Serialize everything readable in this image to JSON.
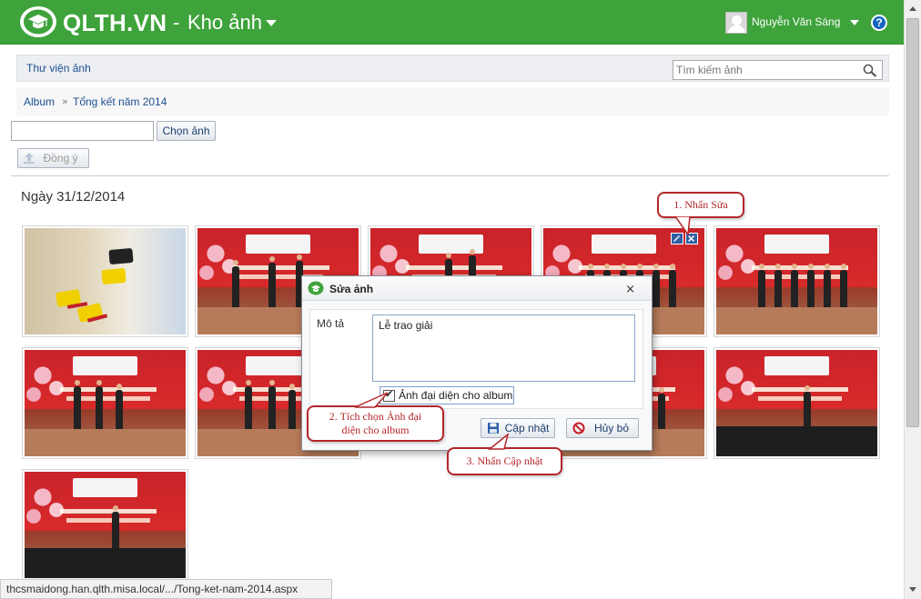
{
  "header": {
    "brand": "QLTH.VN",
    "separator": "-",
    "module": "Kho ảnh",
    "username": "Nguyễn Văn Sáng",
    "help": "?"
  },
  "library": {
    "title": "Thư viện ảnh",
    "search_placeholder": "Tìm kiếm ảnh"
  },
  "breadcrumb": {
    "root": "Album",
    "separator": "»",
    "current": "Tổng kết năm 2014"
  },
  "upload": {
    "choose_label": "Chọn ảnh",
    "agree_label": "Đồng ý"
  },
  "date_heading": "Ngày 31/12/2014",
  "dialog": {
    "title": "Sửa ảnh",
    "close": "×",
    "desc_label": "Mô tả",
    "desc_value": "Lễ trao giải",
    "cover_label": "Ảnh đại diện cho album",
    "update_label": "Cập nhật",
    "cancel_label": "Hủy bỏ"
  },
  "callouts": {
    "c1": "1. Nhấn Sửa",
    "c2_line1": "2. Tích chọn Ảnh đại",
    "c2_line2": "diện cho album",
    "c3": "3. Nhấn Cập nhật"
  },
  "status_url": "thcsmaidong.han.qlth.misa.local/.../Tong-ket-nam-2014.aspx",
  "colors": {
    "header_green": "#3ea33b",
    "link_blue": "#1d4f91",
    "callout_red": "#b3262a"
  }
}
